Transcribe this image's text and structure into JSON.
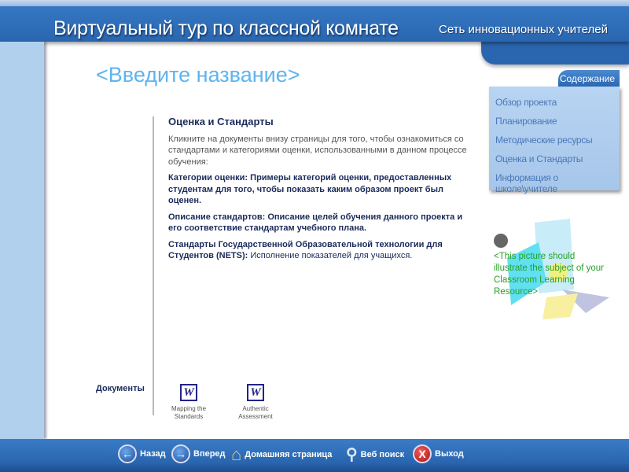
{
  "header": {
    "title": "Виртуальный тур по классной комнате",
    "subtitle": "Сеть инновационных учителей"
  },
  "page_title": "<Введите название>",
  "content": {
    "heading": "Оценка и Стандарты",
    "intro": "Кликните на документы внизу страницы для того, чтобы ознакомиться со стандартами и категориями оценки, использованными в данном процессе обучения:",
    "items": [
      {
        "term": "Категории оценки:",
        "desc": "Примеры категорий оценки, предоставленных студентам для того, чтобы показать каким образом проект был оценен."
      },
      {
        "term": "Описание стандартов:",
        "desc": "Описание целей обучения данного проекта и его соответствие стандартам учебного плана."
      },
      {
        "term": "Стандарты Государственной Образовательной технологии для Студентов (NETS):",
        "desc": "Исполнение показателей для учащихся."
      }
    ]
  },
  "documents": {
    "label": "Документы",
    "items": [
      {
        "icon": "W",
        "name": "Mapping the Standards"
      },
      {
        "icon": "W",
        "name": "Authentic Assessment"
      }
    ]
  },
  "menu": {
    "tab": "Содержание",
    "items": [
      "Обзор проекта",
      "Планирование",
      "Методические ресурсы",
      "Оценка и Стандарты",
      "Информация о школе\\учителе"
    ]
  },
  "picture_caption": "<This picture should illustrate the subject of your Classroom Learning Resource>",
  "footer": {
    "back": "Назад",
    "forward": "Вперед",
    "home": "Домашняя страница",
    "search": "Веб поиск",
    "exit": "Выход"
  }
}
